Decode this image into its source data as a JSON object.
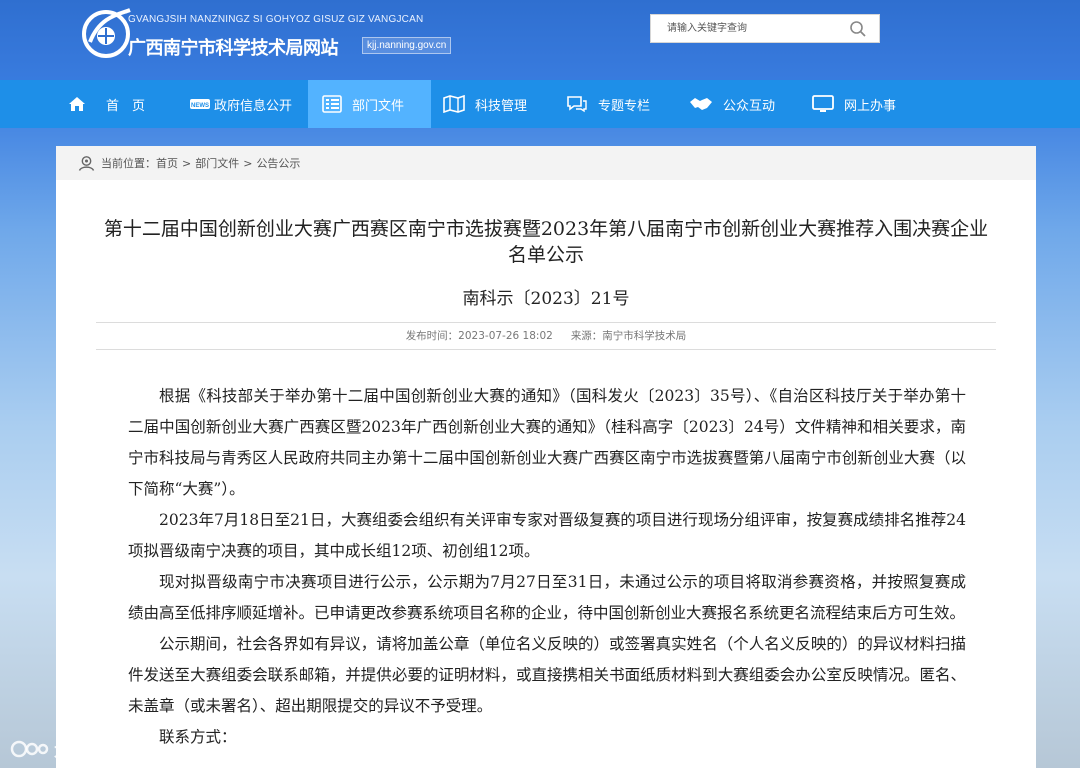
{
  "site": {
    "subtitle": "GVANGJSIH NANZNINGZ SI GOHYOZ GISUZ GIZ VANGJCAN",
    "name": "广西南宁市科学技术局网站",
    "domain": "kjj.nanning.gov.cn"
  },
  "search": {
    "placeholder": "请输入关键字查询"
  },
  "nav": [
    {
      "label": "首　页",
      "icon": "home-icon"
    },
    {
      "label": "政府信息公开",
      "icon": "news-icon"
    },
    {
      "label": "部门文件",
      "icon": "document-list-icon",
      "active": true
    },
    {
      "label": "科技管理",
      "icon": "map-icon"
    },
    {
      "label": "专题专栏",
      "icon": "chat-icon"
    },
    {
      "label": "公众互动",
      "icon": "handshake-icon"
    },
    {
      "label": "网上办事",
      "icon": "monitor-icon"
    }
  ],
  "breadcrumb": {
    "prefix": "当前位置：",
    "items": [
      "首页",
      "部门文件",
      "公告公示"
    ]
  },
  "article": {
    "title": "第十二届中国创新创业大赛广西赛区南宁市选拔赛暨2023年第八届南宁市创新创业大赛推荐入围决赛企业名单公示",
    "doc_number": "南科示〔2023〕21号",
    "publish_time": "发布时间：2023-07-26 18:02",
    "source": "来源：南宁市科学技术局",
    "paragraphs": [
      "根据《科技部关于举办第十二届中国创新创业大赛的通知》（国科发火〔2023〕35号）、《自治区科技厅关于举办第十二届中国创新创业大赛广西赛区暨2023年广西创新创业大赛的通知》（桂科高字〔2023〕24号）文件精神和相关要求，南宁市科技局与青秀区人民政府共同主办第十二届中国创新创业大赛广西赛区南宁市选拔赛暨第八届南宁市创新创业大赛（以下简称“大赛”）。",
      "2023年7月18日至21日，大赛组委会组织有关评审专家对晋级复赛的项目进行现场分组评审，按复赛成绩排名推荐24项拟晋级南宁决赛的项目，其中成长组12项、初创组12项。",
      "现对拟晋级南宁市决赛项目进行公示，公示期为7月27日至31日，未通过公示的项目将取消参赛资格，并按照复赛成绩由高至低排序顺延增补。已申请更改参赛系统项目名称的企业，待中国创新创业大赛报名系统更名流程结束后方可生效。",
      "公示期间，社会各界如有异议，请将加盖公章（单位名义反映的）或签署真实姓名（个人名义反映的）的异议材料扫描件发送至大赛组委会联系邮箱，并提供必要的证明材料，或直接携相关书面纸质材料到大赛组委会办公室反映情况。匿名、未盖章（或未署名）、超出期限提交的异议不予受理。",
      "联系方式："
    ]
  },
  "watermark": "大数跨境"
}
